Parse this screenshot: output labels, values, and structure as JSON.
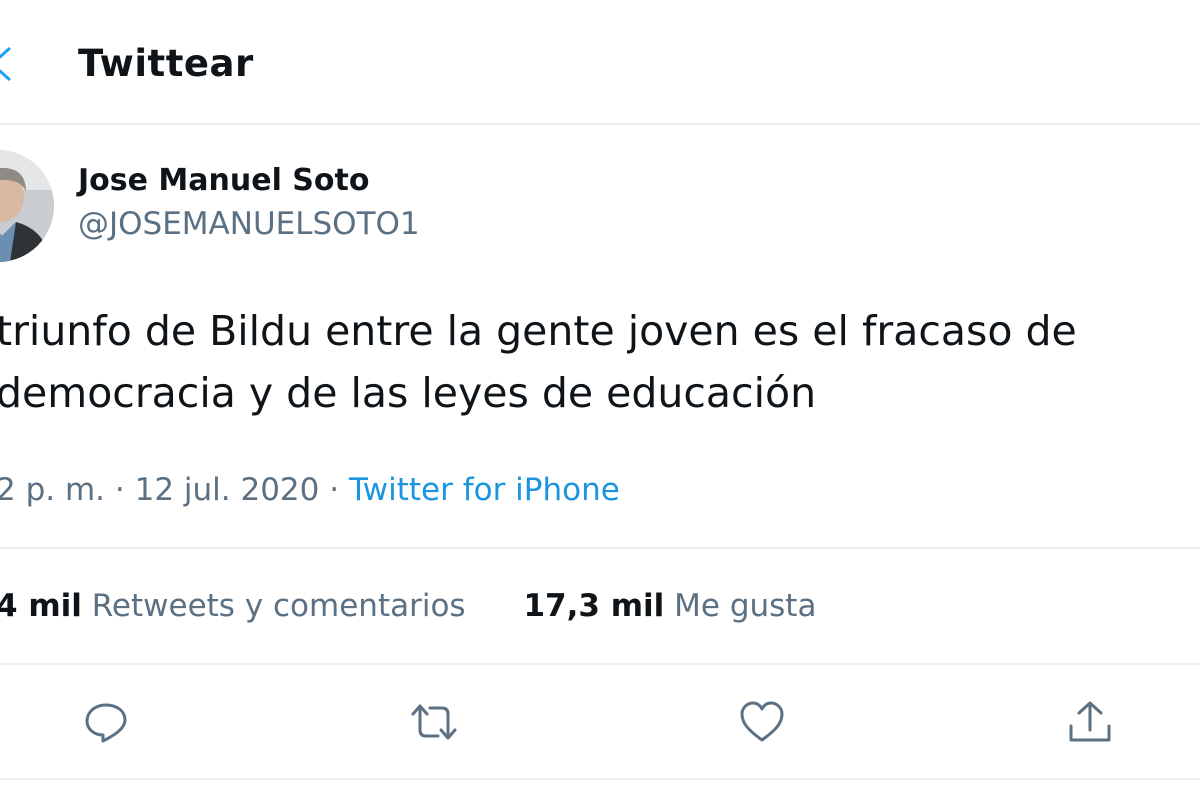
{
  "header": {
    "title": "Twittear"
  },
  "tweet": {
    "author_name": "Jose Manuel Soto",
    "author_handle": "@JOSEMANUELSOTO1",
    "text_line_1": "triunfo de Bildu entre la gente joven es el fracaso de",
    "text_line_2": "democracia y de las leyes de educación",
    "time": "2 p. m.",
    "date": "12 jul. 2020",
    "separator": "·",
    "source": "Twitter for iPhone"
  },
  "stats": {
    "retweets_count": "4 mil",
    "retweets_label": "Retweets y comentarios",
    "likes_count": "17,3 mil",
    "likes_label": "Me gusta"
  },
  "actions": {
    "icons": [
      "reply-icon",
      "retweet-icon",
      "like-icon",
      "share-icon"
    ]
  },
  "colors": {
    "text": "#0f1419",
    "secondary": "#5b7083",
    "link": "#1b95e0",
    "divider": "#eceef0"
  }
}
